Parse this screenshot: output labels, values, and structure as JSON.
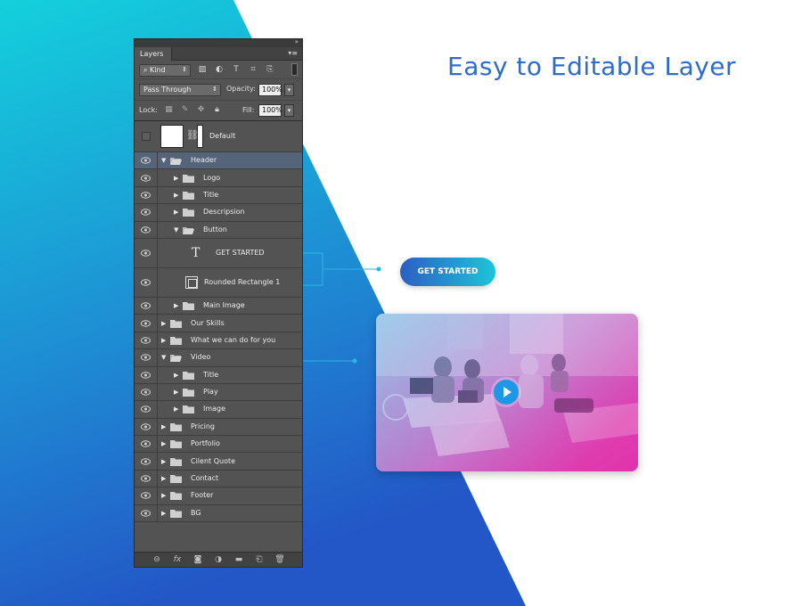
{
  "headline": "Easy to Editable Layer",
  "cta_label": "GET STARTED",
  "panel": {
    "tab": "Layers",
    "kind": "Kind",
    "blend_mode": "Pass Through",
    "opacity_label": "Opacity:",
    "opacity": "100%",
    "lock_label": "Lock:",
    "fill_label": "Fill:",
    "fill": "100%",
    "default_layer": "Default",
    "layers": [
      {
        "name": "Header",
        "indent": 0,
        "open": true,
        "selected": true
      },
      {
        "name": "Logo",
        "indent": 1,
        "open": false
      },
      {
        "name": "Title",
        "indent": 1,
        "open": false
      },
      {
        "name": "Descripsion",
        "indent": 1,
        "open": false
      },
      {
        "name": "Button",
        "indent": 1,
        "open": true
      },
      {
        "name": "GET STARTED",
        "indent": 2,
        "kind": "text"
      },
      {
        "name": "Rounded Rectangle 1",
        "indent": 2,
        "kind": "shape"
      },
      {
        "name": "Main Image",
        "indent": 1,
        "open": false
      },
      {
        "name": "Our Skills",
        "indent": 0,
        "open": false
      },
      {
        "name": "What we can do for you",
        "indent": 0,
        "open": false
      },
      {
        "name": "Video",
        "indent": 0,
        "open": true
      },
      {
        "name": "Title",
        "indent": 1,
        "open": false
      },
      {
        "name": "Play",
        "indent": 1,
        "open": false
      },
      {
        "name": "Image",
        "indent": 1,
        "open": false
      },
      {
        "name": "Pricing",
        "indent": 0,
        "open": false
      },
      {
        "name": "Portfolio",
        "indent": 0,
        "open": false
      },
      {
        "name": "Cilent Quote",
        "indent": 0,
        "open": false
      },
      {
        "name": "Contact",
        "indent": 0,
        "open": false
      },
      {
        "name": "Footer",
        "indent": 0,
        "open": false
      },
      {
        "name": "BG",
        "indent": 0,
        "open": false
      }
    ]
  },
  "colors": {
    "accent": "#2f6bc8",
    "cyan": "#1ec4d9",
    "magenta": "#e23fb0"
  }
}
